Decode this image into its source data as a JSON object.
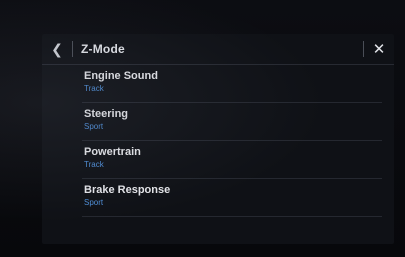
{
  "header": {
    "back_icon": "chevron-left-icon",
    "title": "Z-Mode",
    "close_icon": "close-icon"
  },
  "settings": [
    {
      "label": "Engine Sound",
      "value": "Track"
    },
    {
      "label": "Steering",
      "value": "Sport"
    },
    {
      "label": "Powertrain",
      "value": "Track"
    },
    {
      "label": "Brake Response",
      "value": "Sport"
    }
  ],
  "colors": {
    "background": "#0f1116",
    "accent": "#4f8fd9",
    "text": "#e6e7eb"
  }
}
